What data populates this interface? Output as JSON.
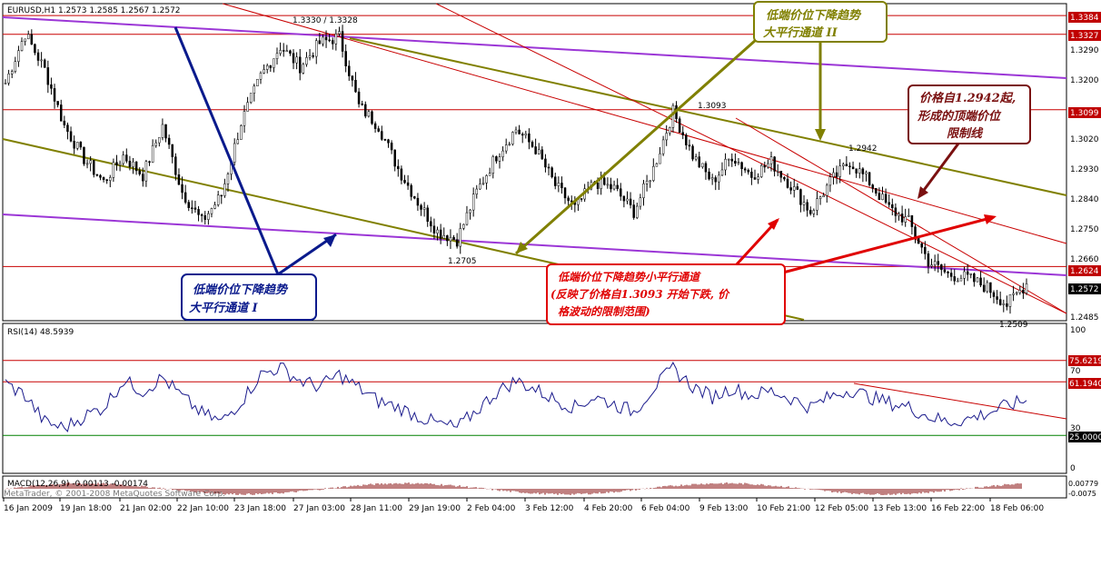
{
  "window": {
    "header": "EURUSD,H1  1.2573 1.2585 1.2567 1.2572"
  },
  "colors": {
    "background": "#ffffff",
    "candle": "#000000",
    "red_line": "#c80000",
    "purple_line": "#9b36d6",
    "olive_line": "#808000",
    "navy": "#0a1a8c",
    "rsi_line": "#1a1a8c",
    "green_line": "#008000",
    "callout_red": "#e00000",
    "callout_darkred": "#7a1010",
    "price_label_bg": "#c00000",
    "current_label_bg": "#000000"
  },
  "main": {
    "price_axis": [
      "1.3384",
      "1.3327",
      "1.3290",
      "1.3200",
      "1.3099",
      "1.3020",
      "1.2930",
      "1.2840",
      "1.2750",
      "1.2660",
      "1.2624",
      "1.2572",
      "1.2485"
    ],
    "highlighted_prices": [
      "1.3384",
      "1.3327",
      "1.3099",
      "1.2624"
    ],
    "current_price": "1.2572",
    "price_annotations": [
      "1.3330 / 1.3328",
      "1.3093",
      "1.2942",
      "1.2705",
      "1.2509"
    ]
  },
  "annotations": {
    "channel_big_1": {
      "line1": "低端价位下降趋势",
      "line2": "大平行通道  I"
    },
    "channel_big_2": {
      "line1": "低端价位下降趋势",
      "line2": "大平行通道  II"
    },
    "top_limit": {
      "line1": "价格自1.2942起,",
      "line2": "形成的顶端价位",
      "line3": "限制线"
    },
    "channel_small": {
      "line1": "低端价位下降趋势小平行通道",
      "line2": "(反映了价格自1.3093 开始下跌, 价",
      "line3": "格波动的限制范围)"
    }
  },
  "rsi": {
    "title": "RSI(14) 48.5939",
    "axis": [
      "100",
      "75.6219",
      "70",
      "61.1940",
      "30",
      "25.0000",
      "0"
    ]
  },
  "macd": {
    "title": "MACD(12,26,9) -0.00113 -0.00174",
    "watermark": "MetaTrader, © 2001-2008 MetaQuotes Software Corp.",
    "axis": [
      "0.00779",
      "-0.0075"
    ]
  },
  "time_axis": [
    "16 Jan 2009",
    "19 Jan 18:00",
    "21 Jan 02:00",
    "22 Jan 10:00",
    "23 Jan 18:00",
    "27 Jan 03:00",
    "28 Jan 11:00",
    "29 Jan 19:00",
    "2 Feb 04:00",
    "3 Feb 12:00",
    "4 Feb 20:00",
    "6 Feb 04:00",
    "9 Feb 13:00",
    "10 Feb 21:00",
    "12 Feb 05:00",
    "13 Feb 13:00",
    "16 Feb 22:00",
    "18 Feb 06:00"
  ],
  "chart_data": {
    "type": "candlestick",
    "symbol": "EURUSD",
    "timeframe": "H1",
    "ylim": [
      1.246,
      1.342
    ],
    "approx_closes": [
      1.318,
      1.333,
      1.322,
      1.305,
      1.295,
      1.288,
      1.296,
      1.29,
      1.305,
      1.285,
      1.276,
      1.284,
      1.306,
      1.32,
      1.329,
      1.323,
      1.33,
      1.332,
      1.311,
      1.305,
      1.292,
      1.282,
      1.273,
      1.2705,
      1.285,
      1.296,
      1.304,
      1.298,
      1.287,
      1.28,
      1.288,
      1.286,
      1.279,
      1.292,
      1.3093,
      1.296,
      1.288,
      1.296,
      1.29,
      1.294,
      1.287,
      1.279,
      1.288,
      1.2942,
      1.288,
      1.28,
      1.276,
      1.264,
      1.26,
      1.259,
      1.256,
      1.2509,
      1.2572
    ],
    "rsi_ylim": [
      0,
      100
    ],
    "rsi_values": [
      60,
      52,
      34,
      30,
      38,
      44,
      62,
      55,
      64,
      51,
      40,
      34,
      48,
      66,
      71,
      62,
      58,
      66,
      57,
      48,
      44,
      38,
      33,
      30,
      42,
      54,
      62,
      56,
      49,
      44,
      51,
      46,
      41,
      57,
      70,
      58,
      51,
      57,
      52,
      55,
      50,
      44,
      51,
      56,
      51,
      47,
      44,
      38,
      34,
      36,
      40,
      45,
      48.59
    ],
    "rsi_levels": [
      75.6219,
      61.194,
      25.0
    ]
  }
}
